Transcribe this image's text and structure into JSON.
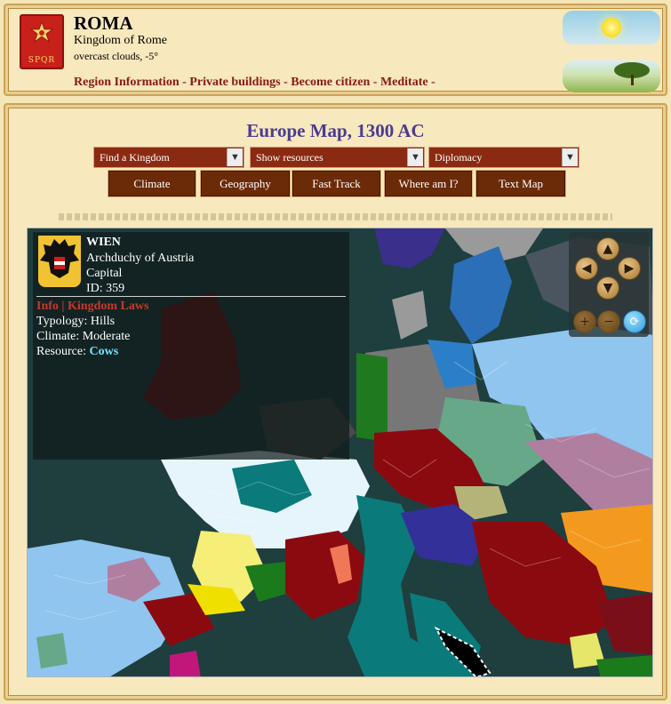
{
  "header": {
    "logo_text": "SPQR",
    "title": "ROMA",
    "subtitle": "Kingdom of Rome",
    "weather": "overcast clouds, -5°",
    "nav": [
      "Region Information",
      "Private buildings",
      "Become citizen",
      "Meditate"
    ],
    "nav_separator": " - "
  },
  "main": {
    "title": "Europe Map, 1300 AC",
    "selects": [
      {
        "label": "Find a Kingdom"
      },
      {
        "label": "Show resources"
      },
      {
        "label": "Diplomacy"
      }
    ],
    "buttons": [
      "Climate",
      "Geography",
      "Fast Track",
      "Where am I?",
      "Text Map"
    ]
  },
  "region": {
    "name": "WIEN",
    "kingdom": "Archduchy of Austria",
    "status": "Capital",
    "id_text": "ID: 359",
    "link_info": "Info",
    "link_separator": "|",
    "link_laws": "Kingdom Laws",
    "typology": "Typology: Hills",
    "climate": "Climate: Moderate",
    "resource_label": "Resource:",
    "resource_value": "Cows"
  },
  "map_controls": {
    "up": "▲",
    "down": "▼",
    "left": "◀",
    "right": "▶",
    "zoom_in": "+",
    "zoom_out": "−",
    "refresh": "⟳"
  },
  "colors": {
    "nav_link": "#8a1a10",
    "title": "#4b3b93",
    "button_bg": "#6b2a08",
    "select_bg": "#8b2a12",
    "resource": "#6ee4ff",
    "info_link": "#c8382c"
  }
}
